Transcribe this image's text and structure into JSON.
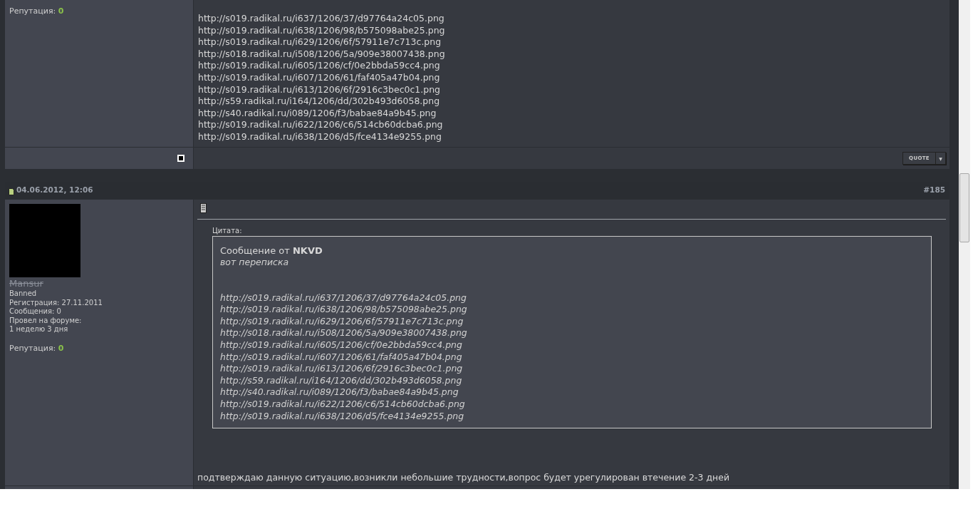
{
  "prev_post": {
    "user": {
      "reputation_label": "Репутация:",
      "reputation_value": "0"
    },
    "lines": [
      "http://s019.radikal.ru/i637/1206/37/d97764a24c05.png",
      "http://s019.radikal.ru/i638/1206/98/b575098abe25.png",
      "http://s019.radikal.ru/i629/1206/6f/57911e7c713c.png",
      "http://s018.radikal.ru/i508/1206/5a/909e38007438.png",
      "http://s019.radikal.ru/i605/1206/cf/0e2bbda59cc4.png",
      "http://s019.radikal.ru/i607/1206/61/faf405a47b04.png",
      "http://s019.radikal.ru/i613/1206/6f/2916c3bec0c1.png",
      "http://s59.radikal.ru/i164/1206/dd/302b493d6058.png",
      "http://s40.radikal.ru/i089/1206/f3/babae84a9b45.png",
      "http://s019.radikal.ru/i622/1206/c6/514cb60dcba6.png",
      "http://s019.radikal.ru/i638/1206/d5/fce4134e9255.png"
    ],
    "select_checked": false,
    "quote_button": "QUOTE",
    "quote_menu": "▼"
  },
  "post": {
    "date": "04.06.2012, 12:06",
    "number": "#185",
    "user": {
      "name": "Mansur",
      "banned": true,
      "title": "Banned",
      "registration": "Регистрация: 27.11.2011",
      "messages": "Сообщения: 0",
      "time_label": "Провел на форуме:",
      "time_value": "1 неделю 3 дня",
      "reputation_label": "Репутация:",
      "reputation_value": "0"
    },
    "quote": {
      "label": "Цитата:",
      "author_prefix": "Сообщение от ",
      "author": "NKVD",
      "text": "вот переписка",
      "lines": [
        "http://s019.radikal.ru/i637/1206/37/d97764a24c05.png",
        "http://s019.radikal.ru/i638/1206/98/b575098abe25.png",
        "http://s019.radikal.ru/i629/1206/6f/57911e7c713c.png",
        "http://s018.radikal.ru/i508/1206/5a/909e38007438.png",
        "http://s019.radikal.ru/i605/1206/cf/0e2bbda59cc4.png",
        "http://s019.radikal.ru/i607/1206/61/faf405a47b04.png",
        "http://s019.radikal.ru/i613/1206/6f/2916c3bec0c1.png",
        "http://s59.radikal.ru/i164/1206/dd/302b493d6058.png",
        "http://s40.radikal.ru/i089/1206/f3/babae84a9b45.png",
        "http://s019.radikal.ru/i622/1206/c6/514cb60dcba6.png",
        "http://s019.radikal.ru/i638/1206/d5/fce4134e9255.png"
      ]
    },
    "message": "подтверждаю данную ситуацию,возникли небольшие трудности,вопрос будет урегулирован втечение 2-3 дней"
  }
}
